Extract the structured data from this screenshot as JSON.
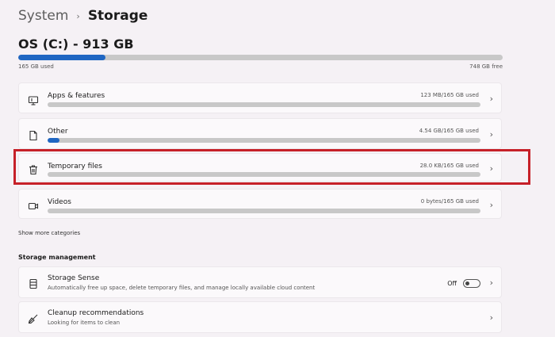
{
  "breadcrumb": {
    "root": "System",
    "separator": "›",
    "current": "Storage"
  },
  "drive": {
    "title": "OS (C:) - 913 GB",
    "used_label": "165 GB used",
    "free_label": "748 GB free",
    "used_fraction": 0.18
  },
  "categories": [
    {
      "label": "Apps & features",
      "usage": "123 MB/165 GB used",
      "fraction": 0.0
    },
    {
      "label": "Other",
      "usage": "4.54 GB/165 GB used",
      "fraction": 0.028
    },
    {
      "label": "Temporary files",
      "usage": "28.0 KB/165 GB used",
      "fraction": 0.0
    },
    {
      "label": "Videos",
      "usage": "0 bytes/165 GB used",
      "fraction": 0.0
    }
  ],
  "show_more": "Show more categories",
  "storage_management": {
    "title": "Storage management",
    "storage_sense": {
      "label": "Storage Sense",
      "description": "Automatically free up space, delete temporary files, and manage locally available cloud content",
      "toggle_label": "Off"
    },
    "cleanup": {
      "label": "Cleanup recommendations",
      "description": "Looking for items to clean"
    }
  },
  "icons": {
    "apps": "apps-monitor-icon",
    "other": "document-icon",
    "temp": "trash-icon",
    "videos": "video-camera-icon",
    "sense": "storage-sense-icon",
    "cleanup": "broom-icon",
    "chevron": "chevron-right-icon"
  },
  "colors": {
    "accent": "#1f66c2",
    "highlight": "#c62028"
  }
}
